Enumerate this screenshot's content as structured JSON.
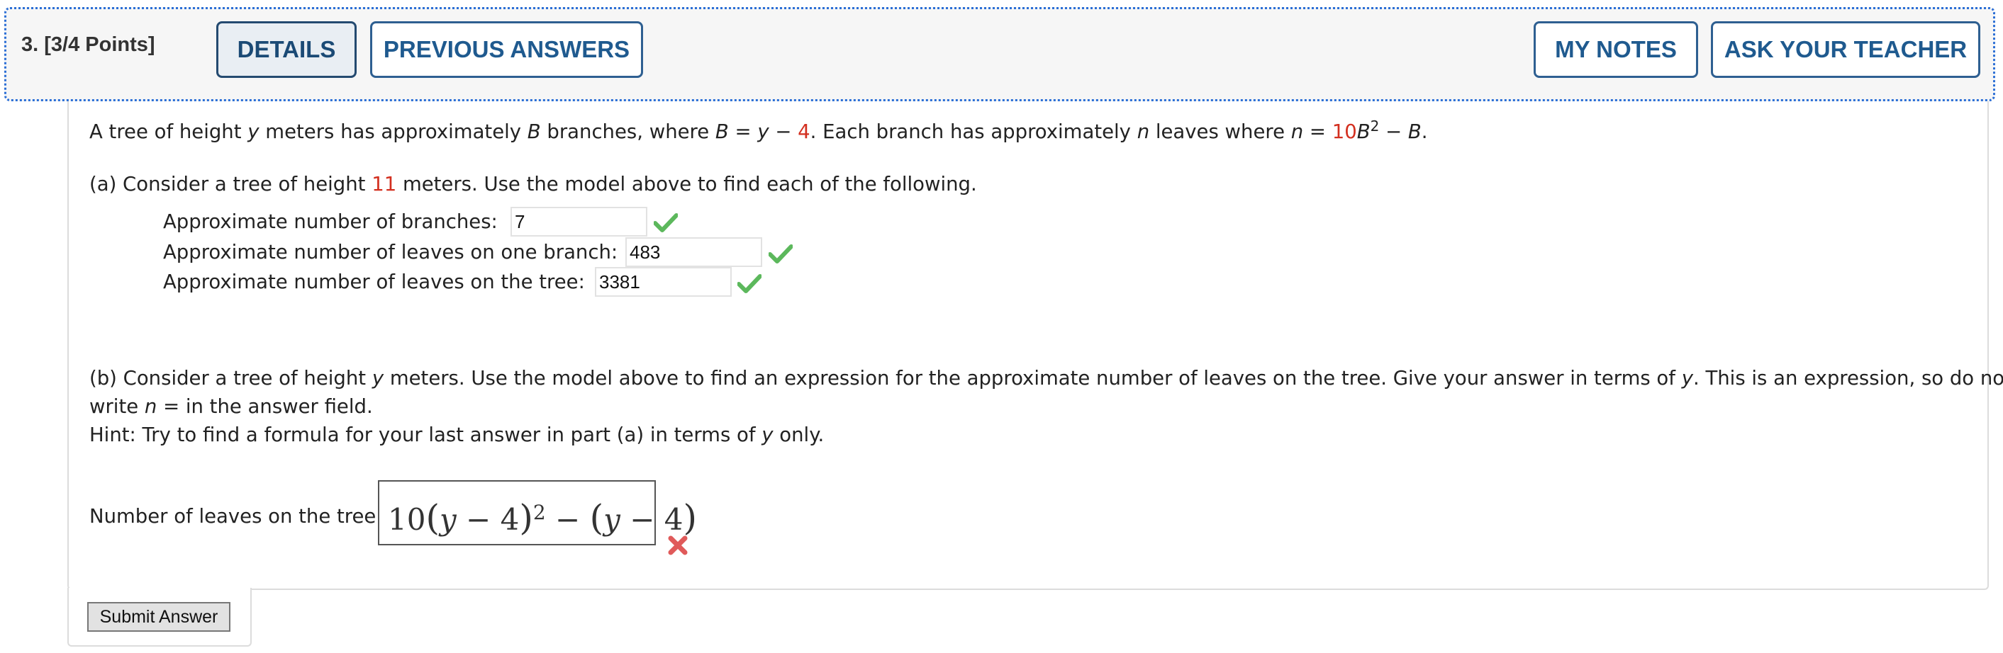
{
  "header": {
    "question_number": "3.",
    "points": "[3/4 Points]",
    "details_label": "DETAILS",
    "previous_answers_label": "PREVIOUS ANSWERS",
    "my_notes_label": "MY NOTES",
    "ask_teacher_label": "ASK YOUR TEACHER"
  },
  "problem": {
    "intro_1": "A tree of height ",
    "var_y": "y",
    "intro_2": " meters has approximately ",
    "var_B": "B",
    "intro_3": " branches, where ",
    "eq_B_lhs": "B",
    "eq_B_mid": " = ",
    "eq_B_y": "y",
    "eq_B_minus": " − ",
    "eq_B_num": "4",
    "intro_4": ". Each branch has approximately ",
    "var_n": "n",
    "intro_5": " leaves where ",
    "eq_n_lhs": "n",
    "eq_n_mid": " = ",
    "eq_n_coef": "10",
    "eq_n_B": "B",
    "eq_n_exp": "2",
    "eq_n_minus": " − ",
    "eq_n_B2": "B",
    "eq_n_end": "."
  },
  "part_a": {
    "prompt_1": "(a) Consider a tree of height ",
    "height_value": "11",
    "prompt_2": " meters. Use the model above to find each of the following.",
    "rows": [
      {
        "label": "Approximate number of branches:",
        "value": "7",
        "status": "correct"
      },
      {
        "label": "Approximate number of leaves on one branch:",
        "value": "483",
        "status": "correct"
      },
      {
        "label": "Approximate number of leaves on the tree:",
        "value": "3381",
        "status": "correct"
      }
    ]
  },
  "part_b": {
    "prompt_1": "(b) Consider a tree of height ",
    "var_y": "y",
    "prompt_2": " meters. Use the model above to find an expression for the approximate number of leaves on the tree. Give your answer in terms of ",
    "var_y2": "y",
    "prompt_3": ". This is an expression, so do not",
    "line2_1": "write ",
    "line2_n": "n",
    "line2_2": " =  in the answer field.",
    "hint_1": "Hint: Try to find a formula for your last answer in part (a) in terms of ",
    "hint_y": "y",
    "hint_2": " only.",
    "answer_label": "Number of leaves on the tree:",
    "answer_status": "incorrect",
    "expr": {
      "coef": "10",
      "open1": "(",
      "y1": "y",
      "minus1": " − ",
      "four1": "4",
      "close1": ")",
      "exp": "2",
      "minus_mid": " − ",
      "open2": "(",
      "y2": "y",
      "minus2": " − ",
      "four2": "4",
      "close2": ")"
    }
  },
  "submit_label": "Submit Answer",
  "colors": {
    "accent_blue": "#1f5a8f",
    "highlight_red": "#d32f1f",
    "check_green": "#5cb85c",
    "x_red": "#e05a5a"
  }
}
